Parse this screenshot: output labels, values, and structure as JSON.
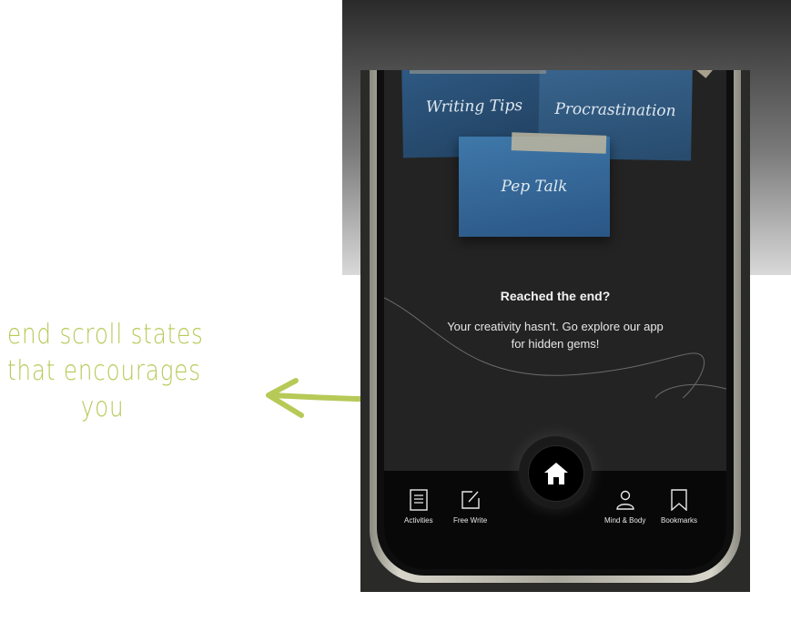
{
  "annotation": {
    "line1": "end scroll states",
    "line2": "that encourages",
    "line3": "you",
    "color": "#b7c957"
  },
  "notes": [
    {
      "label": "Writing Tips"
    },
    {
      "label": "Procrastination"
    },
    {
      "label": "Pep Talk"
    }
  ],
  "end_state": {
    "title": "Reached the end?",
    "body": "Your creativity hasn't. Go explore our app for hidden gems!"
  },
  "tabs": {
    "activities": "Activities",
    "free_write": "Free Write",
    "mind_body": "Mind & Body",
    "bookmarks": "Bookmarks"
  },
  "icons": {
    "activities": "document-list-icon",
    "free_write": "pencil-square-icon",
    "home": "home-icon",
    "mind_body": "person-icon",
    "bookmarks": "bookmark-icon"
  }
}
